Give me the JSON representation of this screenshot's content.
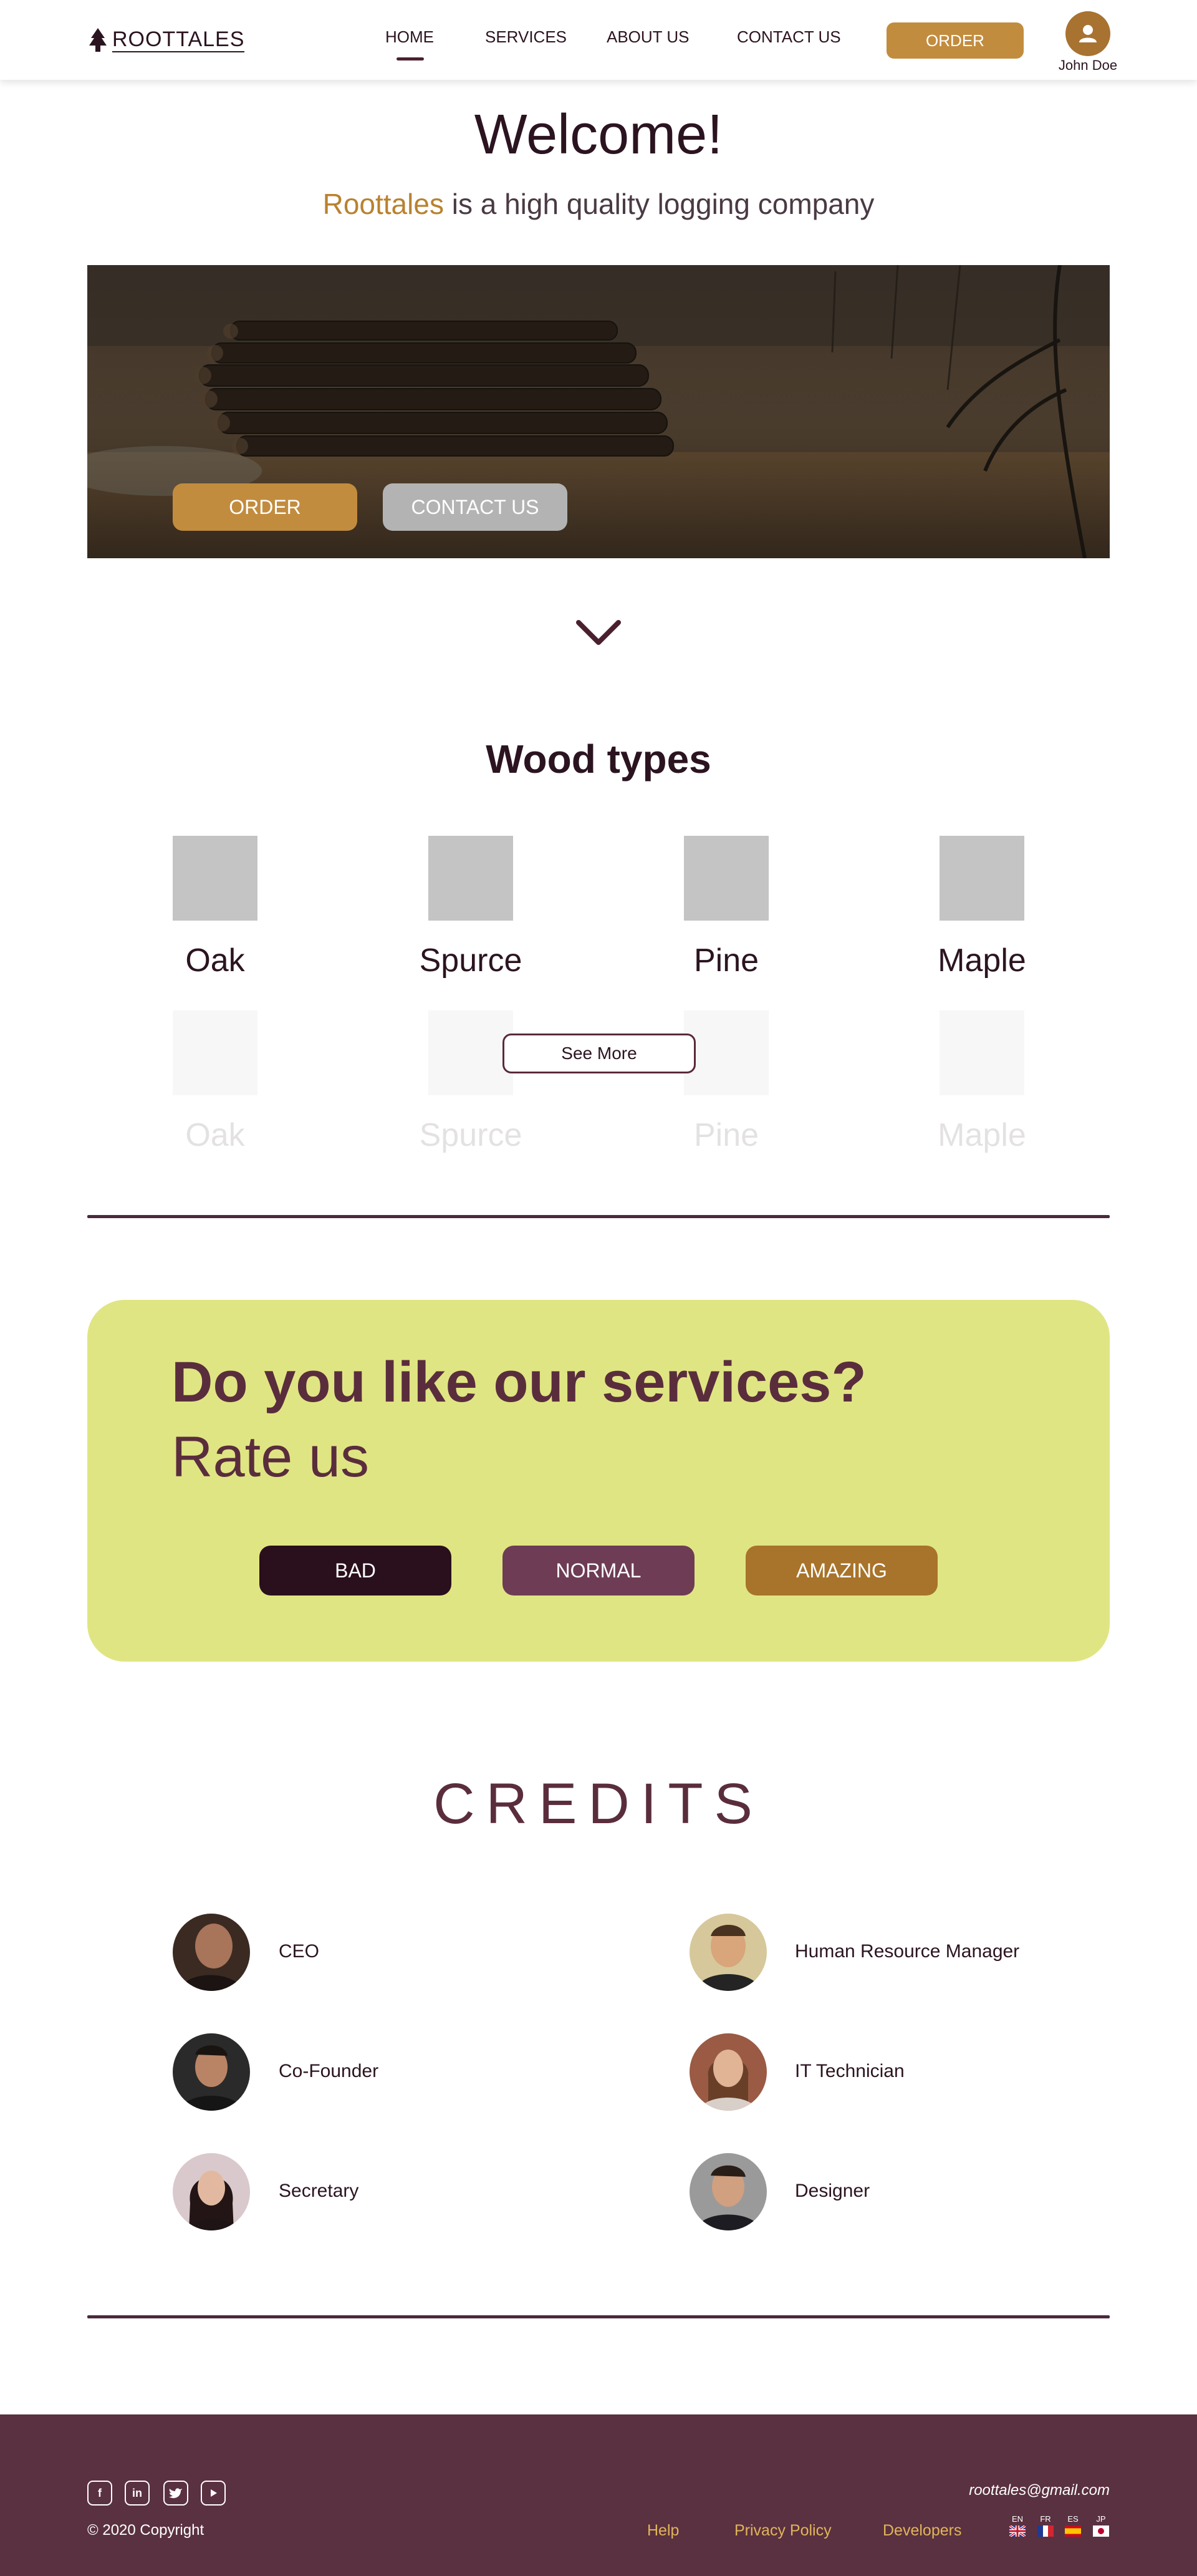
{
  "header": {
    "logo_text": "ROOTTALES",
    "nav": [
      "HOME",
      "SERVICES",
      "ABOUT US",
      "CONTACT US"
    ],
    "active_nav": "HOME",
    "order_label": "ORDER",
    "user_name": "John Doe"
  },
  "welcome": {
    "title": "Welcome!",
    "brand": "Roottales",
    "subtitle_rest": " is a high quality logging company"
  },
  "hero": {
    "order_label": "ORDER",
    "contact_label": "CONTACT US"
  },
  "wood": {
    "title": "Wood types",
    "types": [
      "Oak",
      "Spurce",
      "Pine",
      "Maple"
    ],
    "faded_types": [
      "Oak",
      "Spurce",
      "Pine",
      "Maple"
    ],
    "see_more": "See More"
  },
  "rate": {
    "question": "Do you like our services?",
    "cta": "Rate us",
    "options": [
      {
        "label": "BAD",
        "color": "#2a0f1c"
      },
      {
        "label": "NORMAL",
        "color": "#6e3c55"
      },
      {
        "label": "AMAZING",
        "color": "#a8732a"
      }
    ]
  },
  "credits": {
    "title": "CREDITS",
    "people": [
      {
        "role": "CEO"
      },
      {
        "role": "Human Resource Manager"
      },
      {
        "role": "Co-Founder"
      },
      {
        "role": "IT Technician"
      },
      {
        "role": "Secretary"
      },
      {
        "role": "Designer"
      }
    ]
  },
  "footer": {
    "social": [
      "facebook-icon",
      "linkedin-icon",
      "twitter-icon",
      "youtube-icon"
    ],
    "email": "roottales@gmail.com",
    "copyright": "© 2020 Copyright",
    "links": [
      "Help",
      "Privacy Policy",
      "Developers"
    ],
    "languages": [
      "EN",
      "FR",
      "ES",
      "JP"
    ]
  },
  "colors": {
    "accent": "#c28c3e",
    "brand_text": "#b9822f",
    "primary_dark": "#2b1420",
    "plum": "#5a2d3d",
    "rate_card": "#e0e583",
    "footer_bg": "#5a3140",
    "footer_link": "#e0b45a"
  }
}
